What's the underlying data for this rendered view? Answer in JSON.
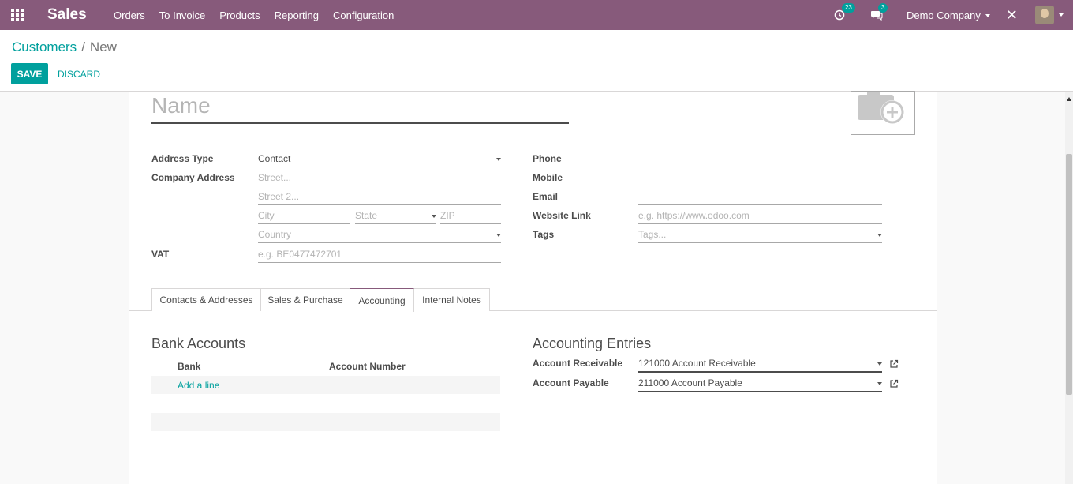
{
  "navbar": {
    "app_name": "Sales",
    "menu": [
      "Orders",
      "To Invoice",
      "Products",
      "Reporting",
      "Configuration"
    ],
    "activity_count": "23",
    "message_count": "3",
    "company": "Demo Company",
    "accent_color": "#875a7b"
  },
  "breadcrumb": {
    "parent": "Customers",
    "separator": "/",
    "current": "New"
  },
  "buttons": {
    "save": "SAVE",
    "discard": "DISCARD"
  },
  "form": {
    "name_placeholder": "Name",
    "left": {
      "address_type": {
        "label": "Address Type",
        "value": "Contact"
      },
      "company_address": {
        "label": "Company Address"
      },
      "street_placeholder": "Street...",
      "street2_placeholder": "Street 2...",
      "city_placeholder": "City",
      "state_placeholder": "State",
      "zip_placeholder": "ZIP",
      "country_placeholder": "Country",
      "vat": {
        "label": "VAT",
        "placeholder": "e.g. BE0477472701"
      }
    },
    "right": {
      "phone": {
        "label": "Phone",
        "value": ""
      },
      "mobile": {
        "label": "Mobile",
        "value": ""
      },
      "email": {
        "label": "Email",
        "value": ""
      },
      "website": {
        "label": "Website Link",
        "placeholder": "e.g. https://www.odoo.com"
      },
      "tags": {
        "label": "Tags",
        "placeholder": "Tags..."
      }
    }
  },
  "tabs": [
    {
      "label": "Contacts & Addresses",
      "active": false
    },
    {
      "label": "Sales & Purchase",
      "active": false
    },
    {
      "label": "Accounting",
      "active": true
    },
    {
      "label": "Internal Notes",
      "active": false
    }
  ],
  "bank_accounts": {
    "title": "Bank Accounts",
    "columns": [
      "Bank",
      "Account Number"
    ],
    "add_line": "Add a line"
  },
  "accounting_entries": {
    "title": "Accounting Entries",
    "receivable": {
      "label": "Account Receivable",
      "value": "121000 Account Receivable"
    },
    "payable": {
      "label": "Account Payable",
      "value": "211000 Account Payable"
    }
  }
}
